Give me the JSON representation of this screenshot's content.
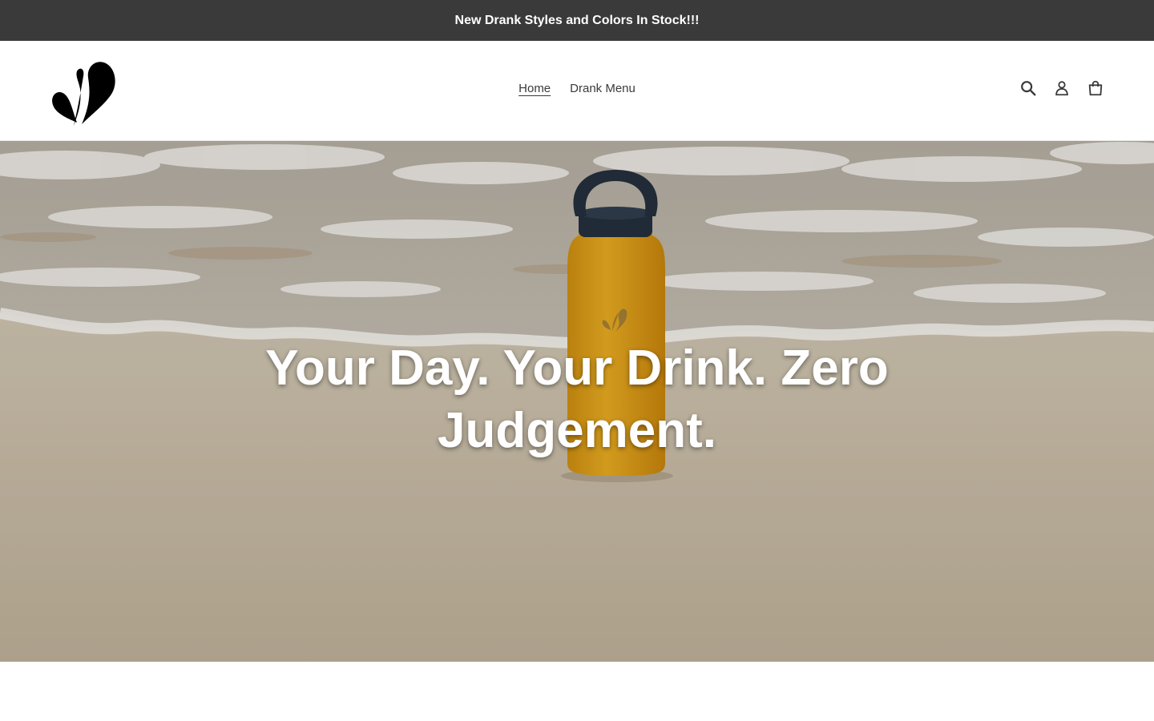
{
  "announcement": {
    "text": "New Drank Styles and Colors In Stock!!!"
  },
  "header": {
    "logo": "drank-splash-logo",
    "nav": [
      {
        "label": "Home",
        "active": true
      },
      {
        "label": "Drank Menu",
        "active": false
      }
    ],
    "icons": [
      "search-icon",
      "account-icon",
      "cart-icon"
    ]
  },
  "hero": {
    "title": "Your Day. Your Drink. Zero Judgement.",
    "image": "yellow bottle on beach"
  },
  "colors": {
    "announcement_bg": "#3a3a3a",
    "text": "#3a3a3a",
    "bottle": "#e6a51c",
    "sand": "#cdbfa9"
  }
}
